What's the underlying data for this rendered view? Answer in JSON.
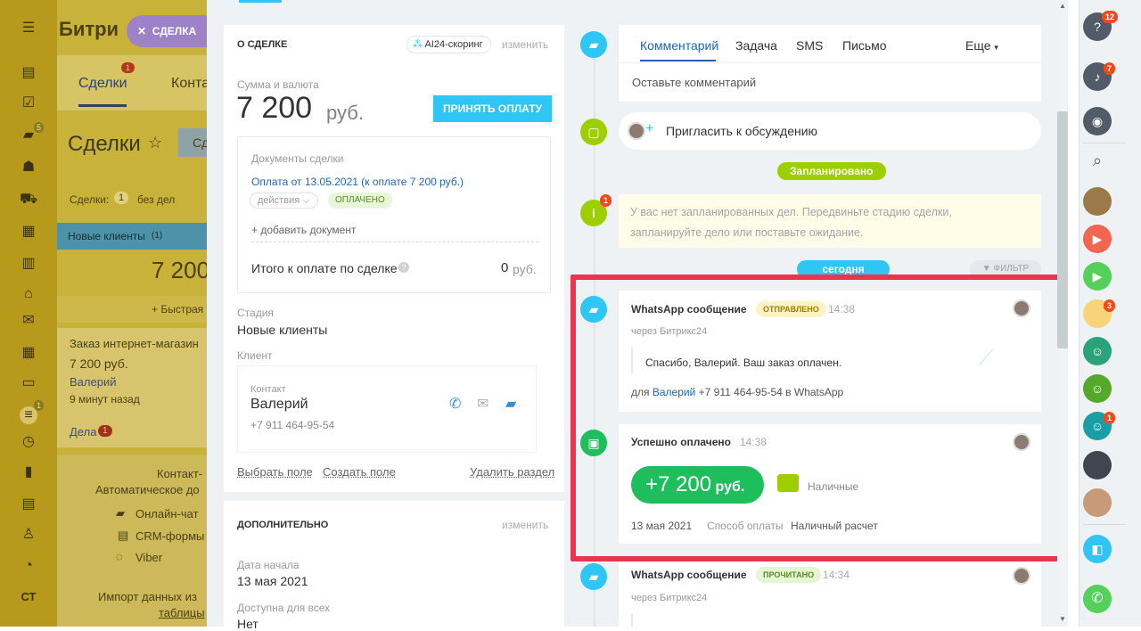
{
  "app": {
    "title_fragment": "Битри",
    "close_label": "СДЕЛКА"
  },
  "leftbar": {
    "badges": [
      "5",
      "1"
    ],
    "cst": "СТ"
  },
  "bg": {
    "tab_deals": "Сделки",
    "tab_contacts": "Конта",
    "tab_badge": "1",
    "page_title": "Сделки",
    "filter_btn": "Сд",
    "counter_label": "Сделки:",
    "counter_value": "1",
    "counter_suffix": "без дел",
    "stage": "Новые клиенты",
    "stage_count": "(1)",
    "stage_sum": "7 200",
    "quick": "+ Быстрая",
    "card_title": "Заказ интернет-магазин",
    "card_sum": "7 200 руб.",
    "card_contact": "Валерий",
    "card_time": "9 минут назад",
    "card_tasks": "Дела",
    "card_tasks_badge": "1",
    "contact_center": "Контакт-",
    "auto": "Автоматическое до",
    "chat": "Онлайн-чат",
    "forms": "CRM-формы",
    "viber": "Viber",
    "import": "Импорт данных из",
    "tables": "таблицы"
  },
  "about": {
    "header": "О СДЕЛКЕ",
    "scoring": "AI24-скоринг",
    "edit": "изменить",
    "sum_label": "Сумма и валюта",
    "sum_value": "7 200",
    "currency": "руб.",
    "accept_btn": "ПРИНЯТЬ ОПЛАТУ",
    "docs_label": "Документы сделки",
    "payment_link": "Оплата от 13.05.2021 (к оплате 7 200 руб.)",
    "actions": "действия",
    "paid": "ОПЛАЧЕНО",
    "add_doc": "+ добавить документ",
    "total_label": "Итого к оплате по сделке",
    "total_value": "0",
    "total_currency": "руб.",
    "stage_label": "Стадия",
    "stage_value": "Новые клиенты",
    "client_label": "Клиент",
    "contact_label": "Контакт",
    "contact_name": "Валерий",
    "contact_phone": "+7 911 464-95-54",
    "select_field": "Выбрать поле",
    "create_field": "Создать поле",
    "delete_section": "Удалить раздел"
  },
  "extra": {
    "header": "ДОПОЛНИТЕЛЬНО",
    "edit": "изменить",
    "start_label": "Дата начала",
    "start_value": "13 мая 2021",
    "avail_label": "Доступна для всех",
    "avail_value": "Нет"
  },
  "timeline": {
    "tabs": [
      "Комментарий",
      "Задача",
      "SMS",
      "Письмо"
    ],
    "more": "Еще",
    "comment_placeholder": "Оставьте комментарий",
    "invite": "Пригласить к обсуждению",
    "planned": "Запланировано",
    "info_badge": "1",
    "no_planned": "У вас нет запланированных дел. Передвиньте стадию сделки, запланируйте дело или поставьте ожидание.",
    "today": "сегодня",
    "filter": "ФИЛЬТР",
    "wa1": {
      "title": "WhatsApp сообщение",
      "status": "ОТПРАВЛЕНО",
      "time": "14:38",
      "via": "через Битрикс24",
      "text": "Спасибо, Валерий. Ваш заказ оплачен.",
      "to_prefix": "для",
      "to_name": "Валерий",
      "to_suffix": "+7 911 464-95-54 в WhatsApp"
    },
    "pay": {
      "title": "Успешно оплачено",
      "time": "14:38",
      "amount": "+7 200",
      "currency": "руб.",
      "method_icon": "wallet-icon",
      "method": "Наличные",
      "date": "13 мая 2021",
      "way_label": "Способ оплаты",
      "way_value": "Наличный расчет"
    },
    "wa2": {
      "title": "WhatsApp сообщение",
      "status": "ПРОЧИТАНО",
      "time": "14:34",
      "via": "через Битрикс24"
    }
  },
  "rightbar": {
    "help_badge": "12",
    "bell_badge": "7",
    "avatar_badge": "3",
    "contact_badge": "1"
  },
  "colors": {
    "accent": "#2fc6f6",
    "green": "#1ebe5c",
    "red": "#e8364f",
    "blue_link": "#2067b0"
  }
}
